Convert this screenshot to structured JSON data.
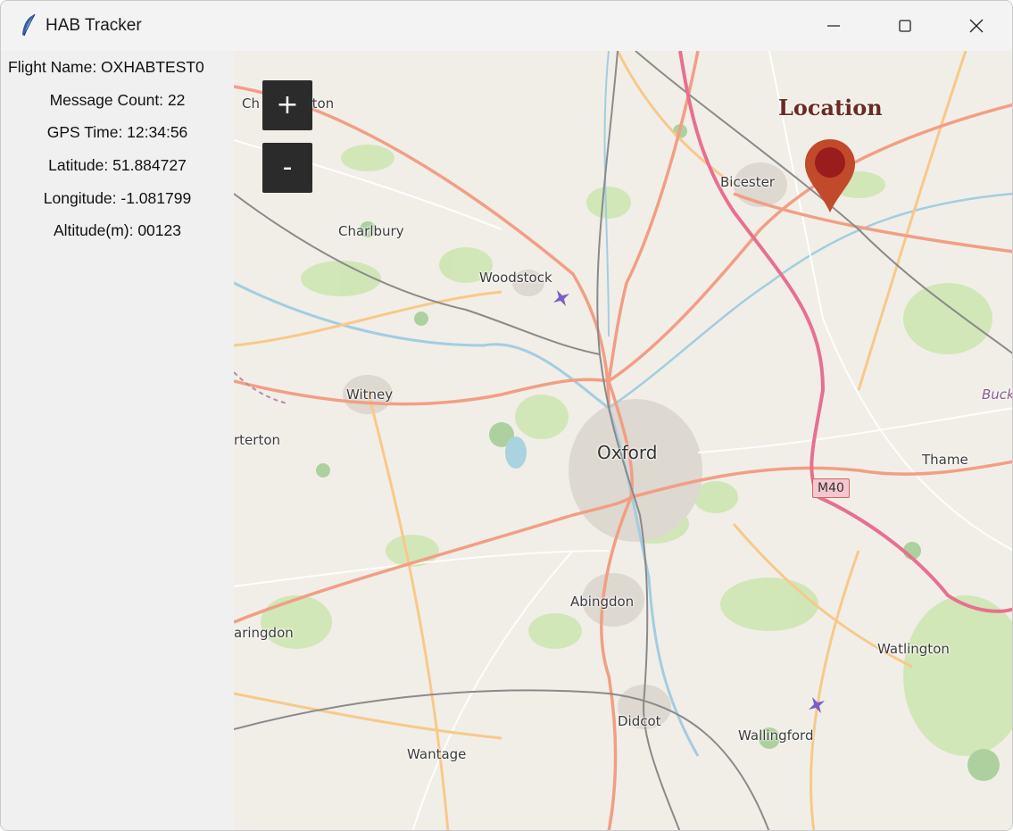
{
  "window": {
    "title": "HAB Tracker",
    "icon": "feather-icon"
  },
  "window_controls": {
    "minimize": "minimize-icon",
    "maximize": "maximize-icon",
    "close": "close-icon"
  },
  "telemetry": {
    "flight_name": "Flight Name: OXHABTEST0",
    "message_count": "Message Count: 22",
    "gps_time": "GPS Time: 12:34:56",
    "latitude": "Latitude: 51.884727",
    "longitude": "Longitude: -1.081799",
    "altitude": "Altitude(m): 00123"
  },
  "map": {
    "zoom_in_label": "+",
    "zoom_out_label": "-",
    "marker_label": "Location",
    "road_shield": "M40",
    "places": {
      "norton": "Norton",
      "chipping": "Ch",
      "bicester": "Bicester",
      "charlbury": "Charlbury",
      "woodstock": "Woodstock",
      "witney": "Witney",
      "brize": "rterton",
      "oxford": "Oxford",
      "thame": "Thame",
      "abingdon": "Abingdon",
      "faringdon": "aringdon",
      "watlington": "Watlington",
      "didcot": "Didcot",
      "wallingford": "Wallingford",
      "wantage": "Wantage",
      "buck": "Buck"
    }
  }
}
